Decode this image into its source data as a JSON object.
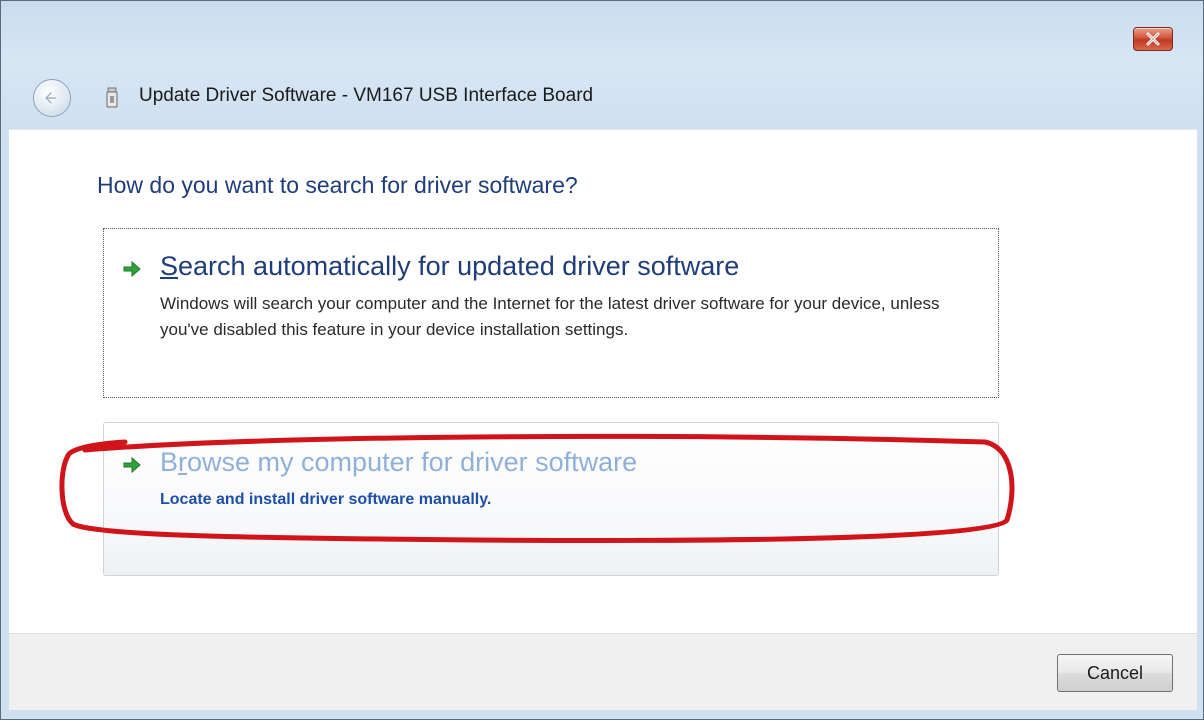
{
  "window": {
    "title": "Update Driver Software - VM167 USB Interface Board",
    "close_icon": "close-icon",
    "back_icon": "back-arrow-icon"
  },
  "content": {
    "heading": "How do you want to search for driver software?",
    "options": [
      {
        "title_accel": "S",
        "title_rest": "earch automatically for updated driver software",
        "description": "Windows will search your computer and the Internet for the latest driver software for your device, unless you've disabled this feature in your device installation settings.",
        "icon": "green-arrow-icon"
      },
      {
        "title_pre": "B",
        "title_accel": "r",
        "title_rest": "owse my computer for driver software",
        "description": "Locate and install driver software manually.",
        "icon": "green-arrow-icon"
      }
    ]
  },
  "footer": {
    "cancel_label": "Cancel"
  },
  "colors": {
    "heading": "#1e3d7a",
    "browse_title": "#8fb0d8",
    "browse_desc": "#1e4fa8",
    "annotation": "#d0141a",
    "arrow": "#2fa33a"
  }
}
